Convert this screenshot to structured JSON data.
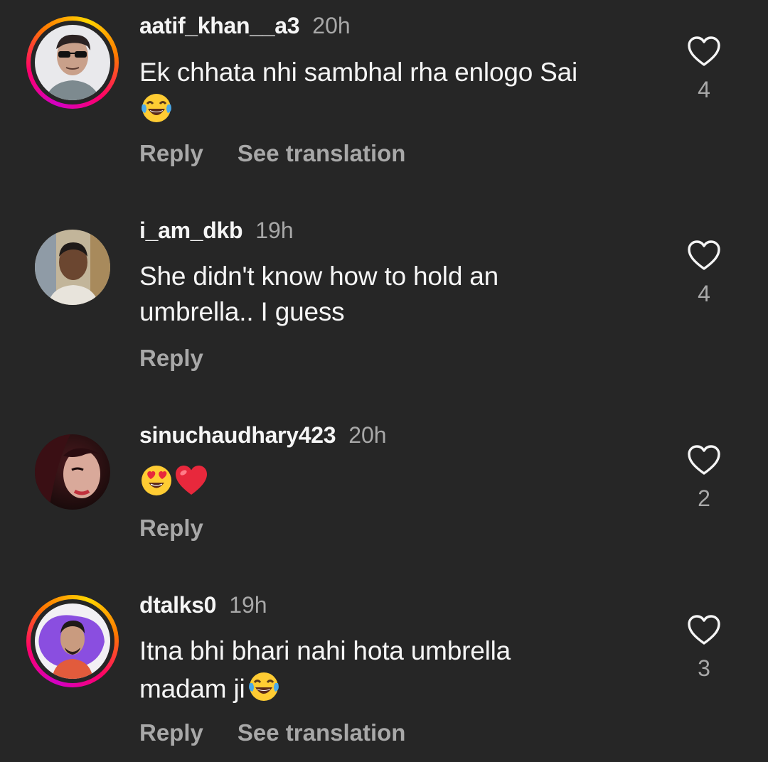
{
  "comments": [
    {
      "username": "aatif_khan__a3",
      "time": "20h",
      "text": "Ek chhata nhi sambhal rha enlogo Sai",
      "emoji": "laughing-tears",
      "reply_label": "Reply",
      "translate_label": "See translation",
      "likes": "4",
      "has_story_ring": true
    },
    {
      "username": "i_am_dkb",
      "time": "19h",
      "text": "She didn't know how to hold an umbrella.. I guess",
      "reply_label": "Reply",
      "likes": "4",
      "has_story_ring": false
    },
    {
      "username": "sinuchaudhary423",
      "time": "20h",
      "text": "",
      "emoji": "heart-eyes + red-heart",
      "reply_label": "Reply",
      "likes": "2",
      "has_story_ring": false
    },
    {
      "username": "dtalks0",
      "time": "19h",
      "text": "Itna bhi bhari nahi hota umbrella madam ji",
      "emoji": "laughing-tears",
      "reply_label": "Reply",
      "translate_label": "See translation",
      "likes": "3",
      "has_story_ring": true
    }
  ],
  "colors": {
    "background": "#262626",
    "primary_text": "#f5f5f5",
    "secondary_text": "#a8a8a8"
  }
}
